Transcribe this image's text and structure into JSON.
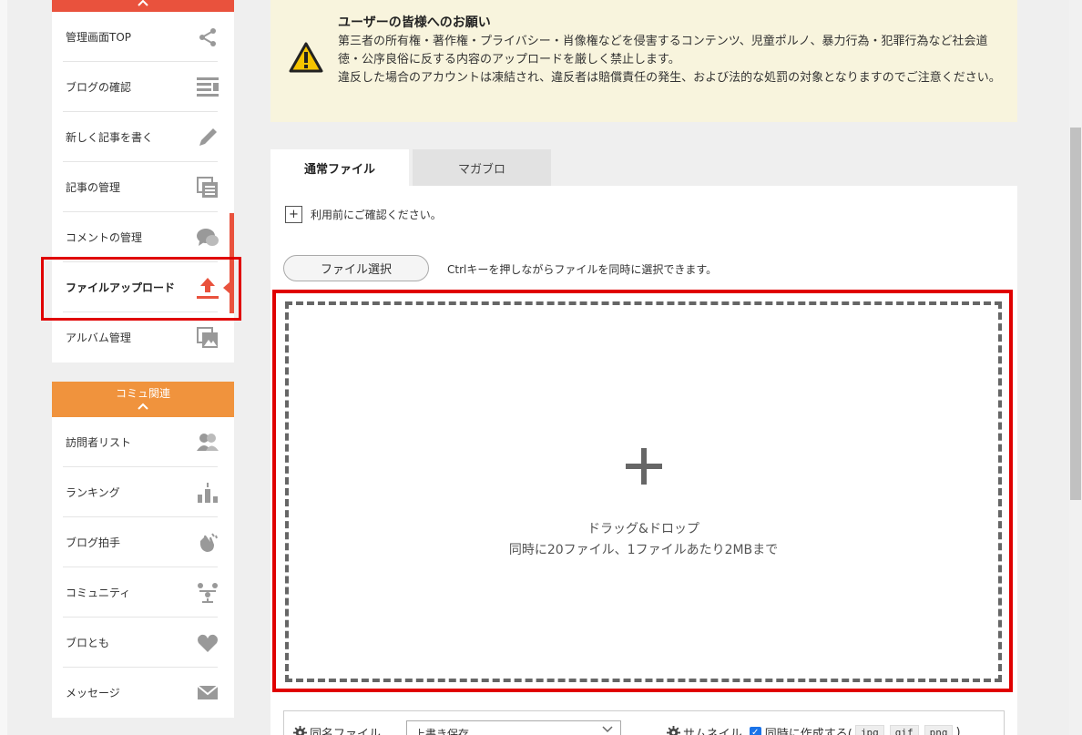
{
  "sidebar": {
    "group1_items": [
      {
        "label": "管理画面TOP",
        "icon": "share-icon"
      },
      {
        "label": "ブログの確認",
        "icon": "list-icon"
      },
      {
        "label": "新しく記事を書く",
        "icon": "pencil-icon"
      },
      {
        "label": "記事の管理",
        "icon": "documents-icon"
      },
      {
        "label": "コメントの管理",
        "icon": "comment-icon"
      },
      {
        "label": "ファイルアップロード",
        "icon": "upload-icon",
        "active": true
      },
      {
        "label": "アルバム管理",
        "icon": "album-icon"
      }
    ],
    "group2_title": "コミュ関連",
    "group2_items": [
      {
        "label": "訪問者リスト",
        "icon": "users-icon"
      },
      {
        "label": "ランキング",
        "icon": "ranking-icon"
      },
      {
        "label": "ブログ拍手",
        "icon": "clap-icon"
      },
      {
        "label": "コミュニティ",
        "icon": "community-icon"
      },
      {
        "label": "ブロとも",
        "icon": "heart-icon"
      },
      {
        "label": "メッセージ",
        "icon": "message-icon"
      }
    ]
  },
  "notice": {
    "title": "ユーザーの皆様へのお願い",
    "line1": "第三者の所有権・著作権・プライバシー・肖像権などを侵害するコンテンツ、児童ポルノ、暴力行為・犯罪行為など社会道徳・公序良俗に反する内容のアップロードを厳しく禁止します。",
    "line2": "違反した場合のアカウントは凍結され、違反者は賠償責任の発生、および法的な処罰の対象となりますのでご注意ください。"
  },
  "tabs": [
    {
      "label": "通常ファイル"
    },
    {
      "label": "マガブロ"
    }
  ],
  "upload": {
    "confirm_label": "利用前にご確認ください。",
    "file_button": "ファイル選択",
    "file_hint": "Ctrlキーを押しながらファイルを同時に選択できます。",
    "drop_title": "ドラッグ&ドロップ",
    "drop_sub": "同時に20ファイル、1ファイルあたり2MBまで"
  },
  "options": {
    "same_name_label": "同名ファイル",
    "same_name_value": "上書き保存",
    "thumbnail_label": "サムネイル",
    "thumbnail_check": "同時に作成する(",
    "formats": [
      "jpg",
      "gif",
      "png"
    ],
    "close_paren": ")"
  },
  "colors": {
    "accent_red": "#e9523d",
    "accent_orange": "#f0933d",
    "highlight": "#e00000"
  }
}
